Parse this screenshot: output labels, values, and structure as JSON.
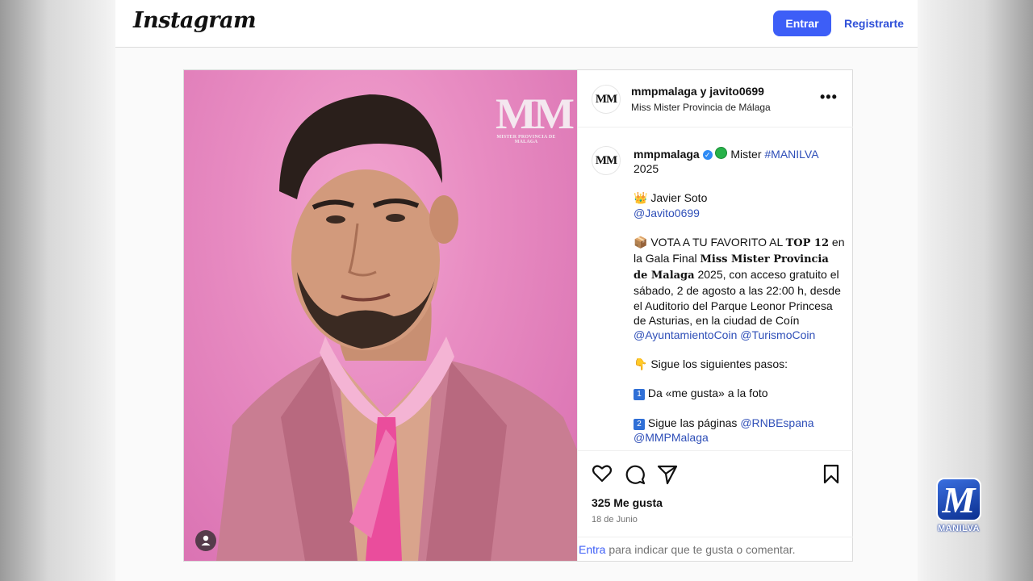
{
  "topbar": {
    "logo": "Instagram",
    "login_label": "Entrar",
    "register_label": "Registrarte"
  },
  "post": {
    "image": {
      "watermark_mm": "MM",
      "watermark_sub": "MISTER PROVINCIA DE MALAGA"
    },
    "header": {
      "avatar_text": "MM",
      "users": "mmpmalaga y javito0699",
      "subtitle": "Miss Mister Provincia de Málaga"
    },
    "caption": {
      "avatar_text": "MM",
      "username": "mmpmalaga",
      "line1_text": "Mister",
      "line1_tag": "#MANILVA",
      "line1_year": "2025",
      "crown_emoji": "👑",
      "name": "Javier Soto",
      "mention_javito": "@Javito0699",
      "vote_emoji": "📦",
      "vote_prefix": "VOTA A TU FAVORITO AL",
      "vote_top": "TOP 12",
      "vote_mid": "en la Gala Final",
      "vote_event": "Miss Mister Provincia de Malaga",
      "vote_rest": "2025, con acceso gratuito el sábado, 2 de agosto a las 22:00 h, desde el Auditorio del Parque Leonor Princesa de Asturias, en la ciudad de Coín",
      "mention_ayto": "@AyuntamientoCoin",
      "mention_turismo": "@TurismoCoin",
      "point_emoji": "👇",
      "steps_title": "Sigue los siguientes pasos:",
      "step1_num": "1",
      "step1": "Da «me gusta» a la foto",
      "step2_num": "2",
      "step2": "Sigue las páginas",
      "mention_rnb": "@RNBEspana",
      "mention_mmp": "@MMPMalaga"
    },
    "likes": "325 Me gusta",
    "date": "18 de Junio",
    "comment_enter": "Entra",
    "comment_rest": "para indicar que te gusta o comentar."
  },
  "overlay": {
    "badge_letter": "M",
    "badge_text": "MANILVA"
  },
  "colors": {
    "accent": "#3d5ef7",
    "link": "#2f4fb8",
    "photo_bg": "#e88cc2",
    "badge_blue": "#1a3fa8"
  }
}
